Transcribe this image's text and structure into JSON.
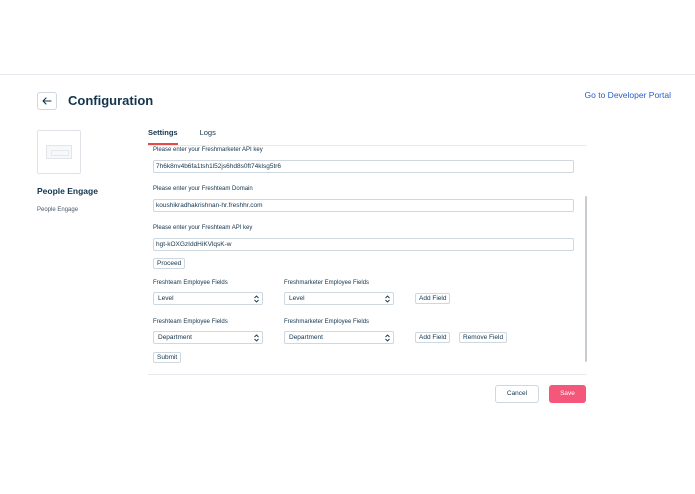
{
  "header": {
    "title": "Configuration",
    "back_icon": "arrow-left-icon",
    "developer_portal_link": "Go to Developer Portal"
  },
  "app": {
    "name": "People Engage",
    "subtitle": "People Engage",
    "icon": "app-placeholder-icon"
  },
  "tabs": [
    {
      "label": "Settings",
      "active": true
    },
    {
      "label": "Logs",
      "active": false
    }
  ],
  "form": {
    "freshmarketer_key_label": "Please enter your Freshmarketer API key",
    "freshmarketer_key_value": "7h6k8nv4b6fa1tsh1l52js6hd8s0ft74klsg5tr6",
    "freshteam_domain_label": "Please enter your Freshteam Domain",
    "freshteam_domain_value": "koushikradhakrishnan-hr.freshhr.com",
    "freshteam_key_label": "Please enter your Freshteam API key",
    "freshteam_key_value": "hgt-kOXGzIddHiKVlqsK-w",
    "proceed_label": "Proceed",
    "mappings": [
      {
        "freshteam_label": "Freshteam Employee Fields",
        "freshteam_value": "Level",
        "freshmarketer_label": "Freshmarketer Employee Fields",
        "freshmarketer_value": "Level",
        "add_label": "Add Field"
      },
      {
        "freshteam_label": "Freshteam Employee Fields",
        "freshteam_value": "Department",
        "freshmarketer_label": "Freshmarketer Employee Fields",
        "freshmarketer_value": "Department",
        "add_label": "Add Field",
        "remove_label": "Remove Field"
      }
    ],
    "submit_label": "Submit"
  },
  "footer": {
    "cancel_label": "Cancel",
    "save_label": "Save"
  },
  "colors": {
    "accent": "#e54b4b",
    "save_bg": "#f4577a",
    "link": "#2c5cc5",
    "text": "#12344d"
  }
}
